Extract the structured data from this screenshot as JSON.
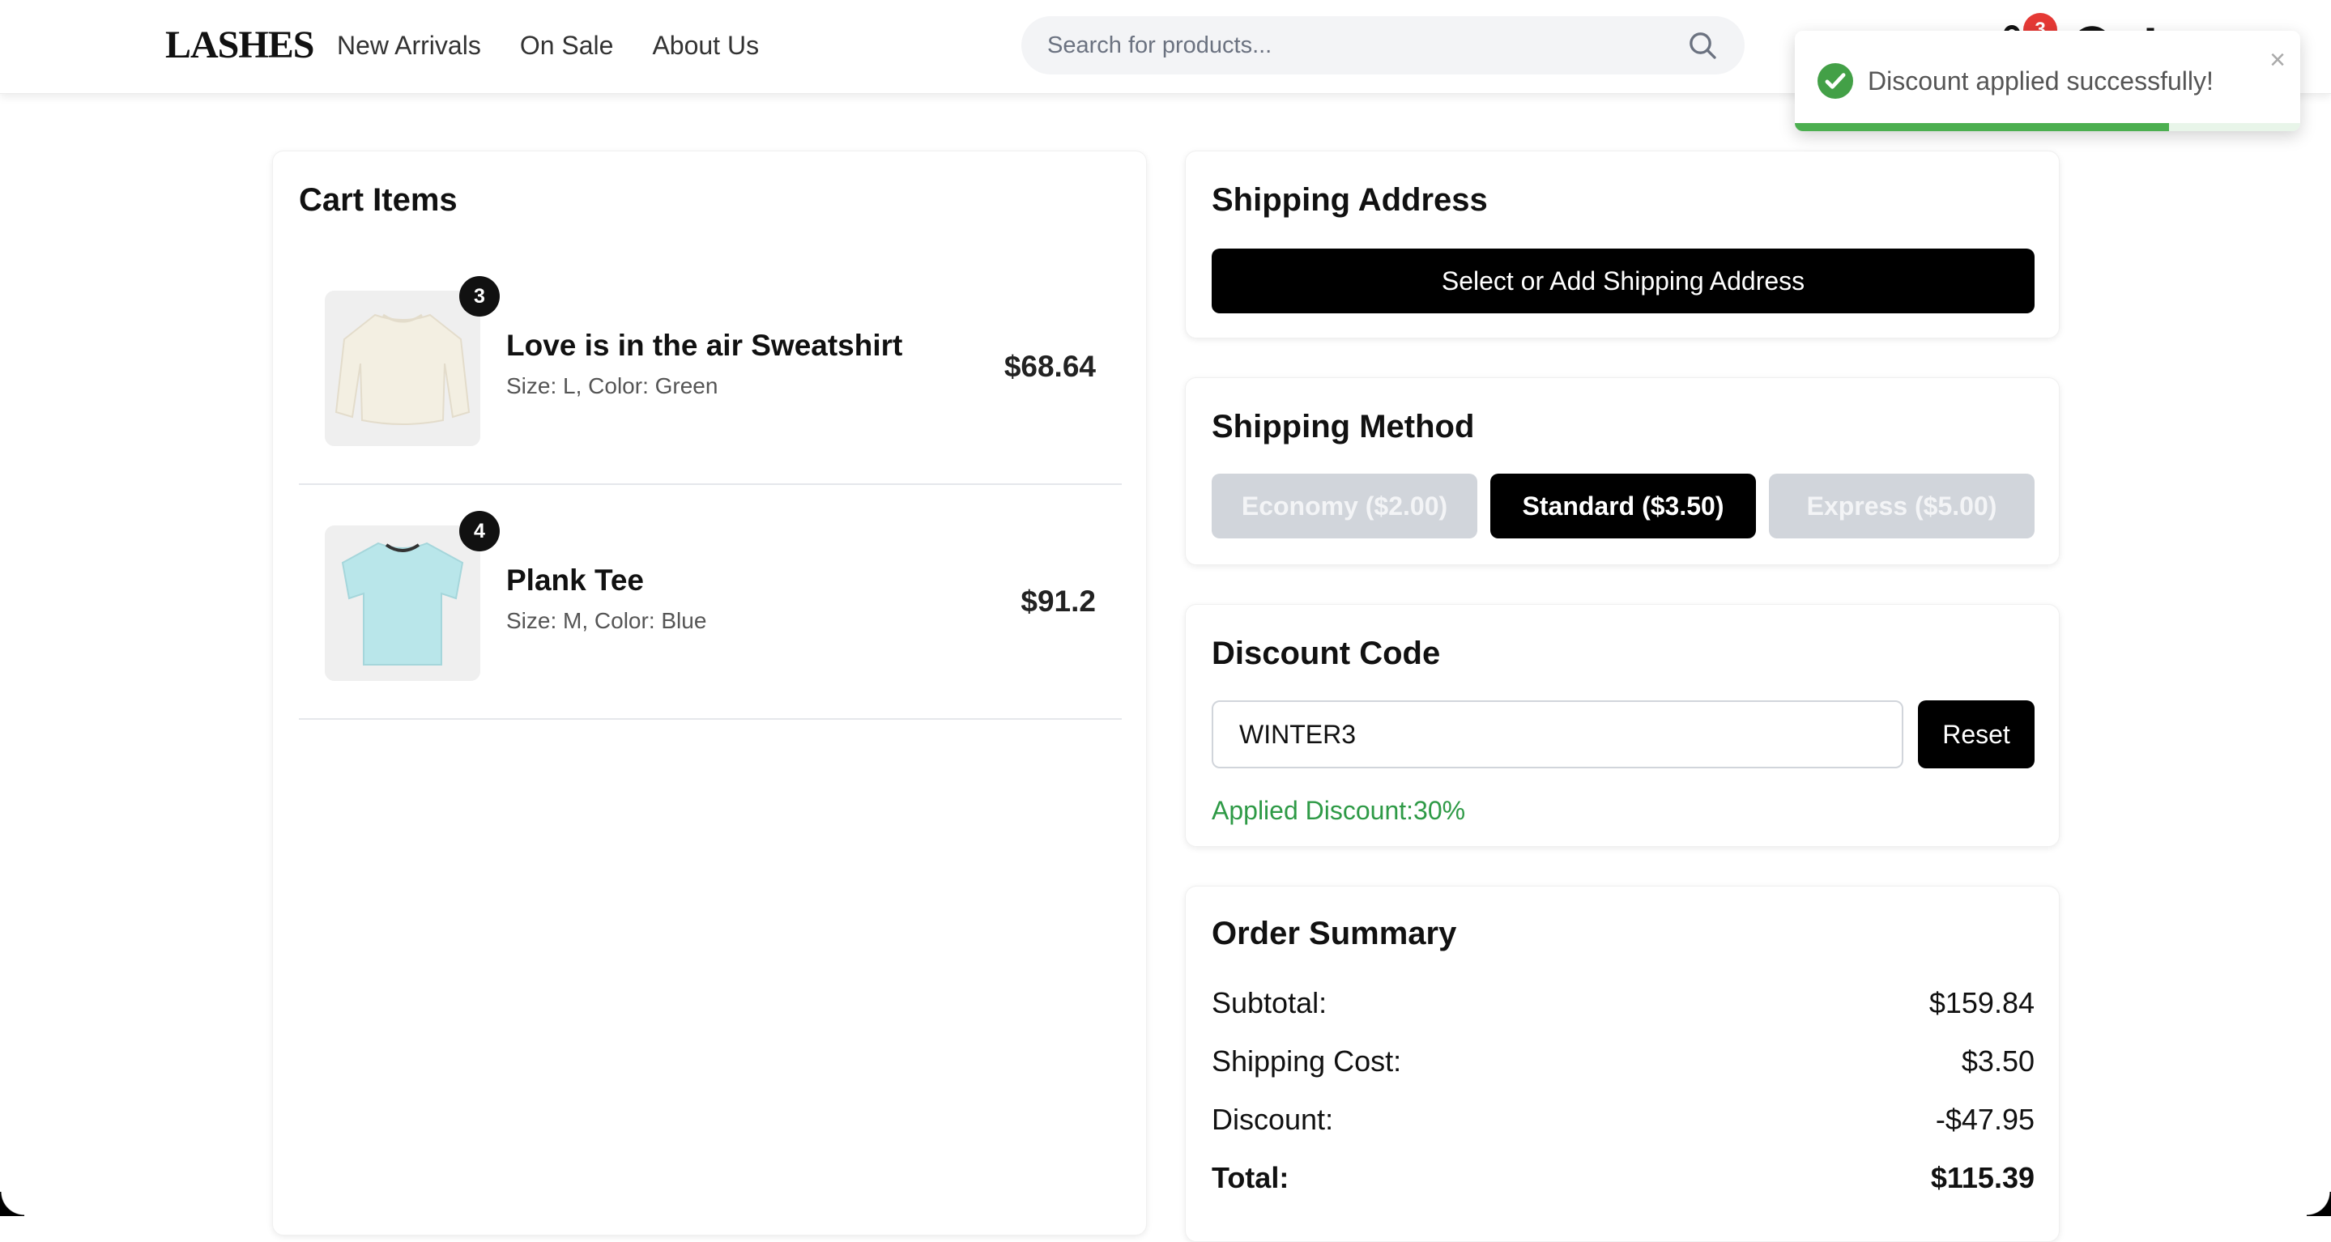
{
  "header": {
    "logo": "LASHES",
    "nav": [
      {
        "label": "New Arrivals"
      },
      {
        "label": "On Sale"
      },
      {
        "label": "About Us"
      }
    ],
    "search": {
      "placeholder": "Search for products..."
    },
    "cart_count": "3"
  },
  "toast": {
    "message": "Discount applied successfully!",
    "close": "×",
    "progress_fraction": 0.74,
    "color": "#4caf50"
  },
  "cart": {
    "title": "Cart Items",
    "items": [
      {
        "name": "Love is in the air Sweatshirt",
        "meta": "Size: L, Color: Green",
        "price": "$68.64",
        "quantity": "3",
        "image_icon": "sweatshirt-icon",
        "image_color": "#f3efe2"
      },
      {
        "name": "Plank Tee",
        "meta": "Size: M, Color: Blue",
        "price": "$91.2",
        "quantity": "4",
        "image_icon": "tshirt-icon",
        "image_color": "#b9e6ea"
      }
    ]
  },
  "shipping_address": {
    "title": "Shipping Address",
    "button": "Select or Add Shipping Address"
  },
  "shipping_method": {
    "title": "Shipping Method",
    "options": [
      {
        "label": "Economy ($2.00)",
        "selected": false
      },
      {
        "label": "Standard ($3.50)",
        "selected": true
      },
      {
        "label": "Express ($5.00)",
        "selected": false
      }
    ]
  },
  "discount": {
    "title": "Discount Code",
    "value": "WINTER3",
    "reset_label": "Reset",
    "applied": "Applied Discount:30%",
    "applied_color": "#2e9a46"
  },
  "summary": {
    "title": "Order Summary",
    "rows": [
      {
        "label": "Subtotal:",
        "value": "$159.84"
      },
      {
        "label": "Shipping Cost:",
        "value": "$3.50"
      },
      {
        "label": "Discount:",
        "value": "-$47.95"
      }
    ],
    "total": {
      "label": "Total:",
      "value": "$115.39"
    }
  }
}
